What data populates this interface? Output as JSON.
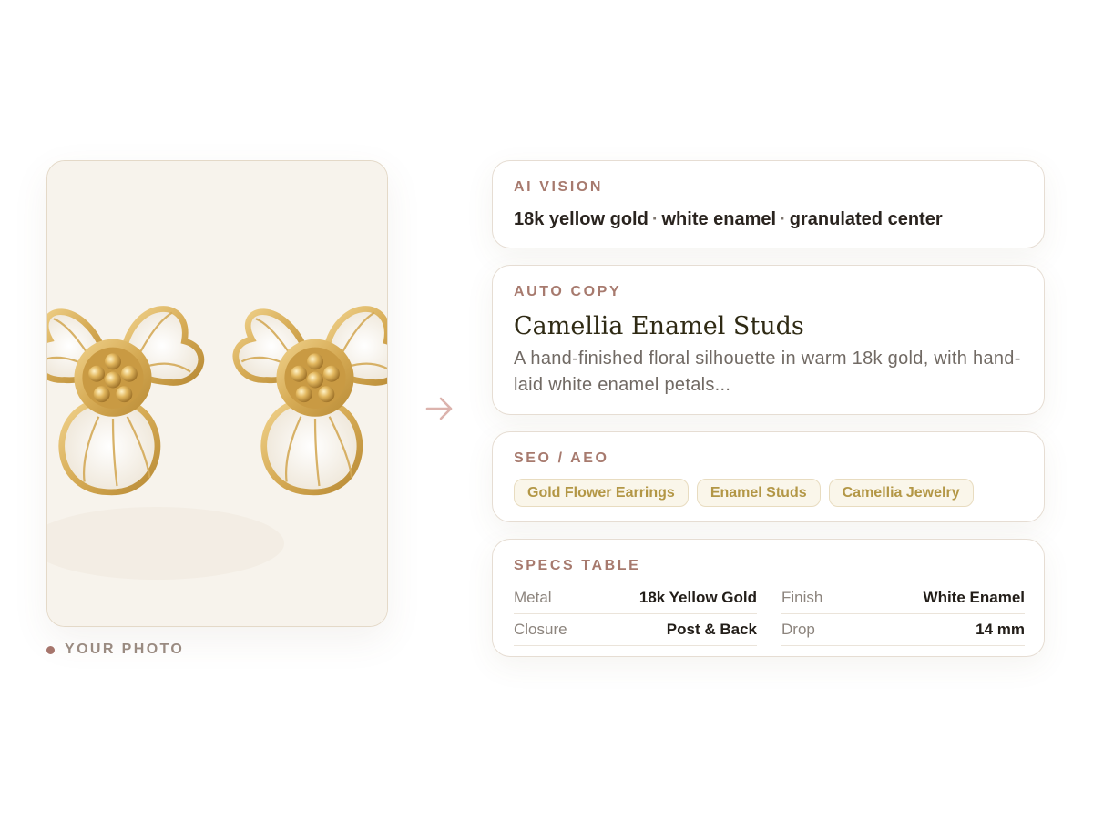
{
  "photo": {
    "caption": "YOUR PHOTO",
    "subject": "gold-flower-enamel-earrings",
    "colors": {
      "gold": "#d6ab55",
      "enamel": "#f4efe6",
      "background": "#f7f3ec"
    }
  },
  "arrow": {
    "icon": "arrow-right-icon",
    "color": "#dcb3ad"
  },
  "ai_vision": {
    "label": "AI VISION",
    "attributes": [
      "18k yellow gold",
      "white enamel",
      "granulated center"
    ],
    "separator": "·"
  },
  "auto_copy": {
    "label": "AUTO COPY",
    "title": "Camellia Enamel Studs",
    "body": "A hand-finished floral silhouette in warm 18k gold, with hand-laid white enamel petals..."
  },
  "seo": {
    "label": "SEO / AEO",
    "tags": [
      "Gold Flower Earrings",
      "Enamel Studs",
      "Camellia Jewelry"
    ]
  },
  "specs": {
    "label": "SPECS TABLE",
    "rows": [
      {
        "key": "Metal",
        "value": "18k Yellow Gold"
      },
      {
        "key": "Finish",
        "value": "White Enamel"
      },
      {
        "key": "Closure",
        "value": "Post & Back"
      },
      {
        "key": "Drop",
        "value": "14 mm"
      }
    ]
  },
  "colors": {
    "label_accent": "#a77a6e",
    "tag_text": "#b39746",
    "tag_bg": "#faf6ea",
    "panel_border": "#e6ddd3"
  }
}
